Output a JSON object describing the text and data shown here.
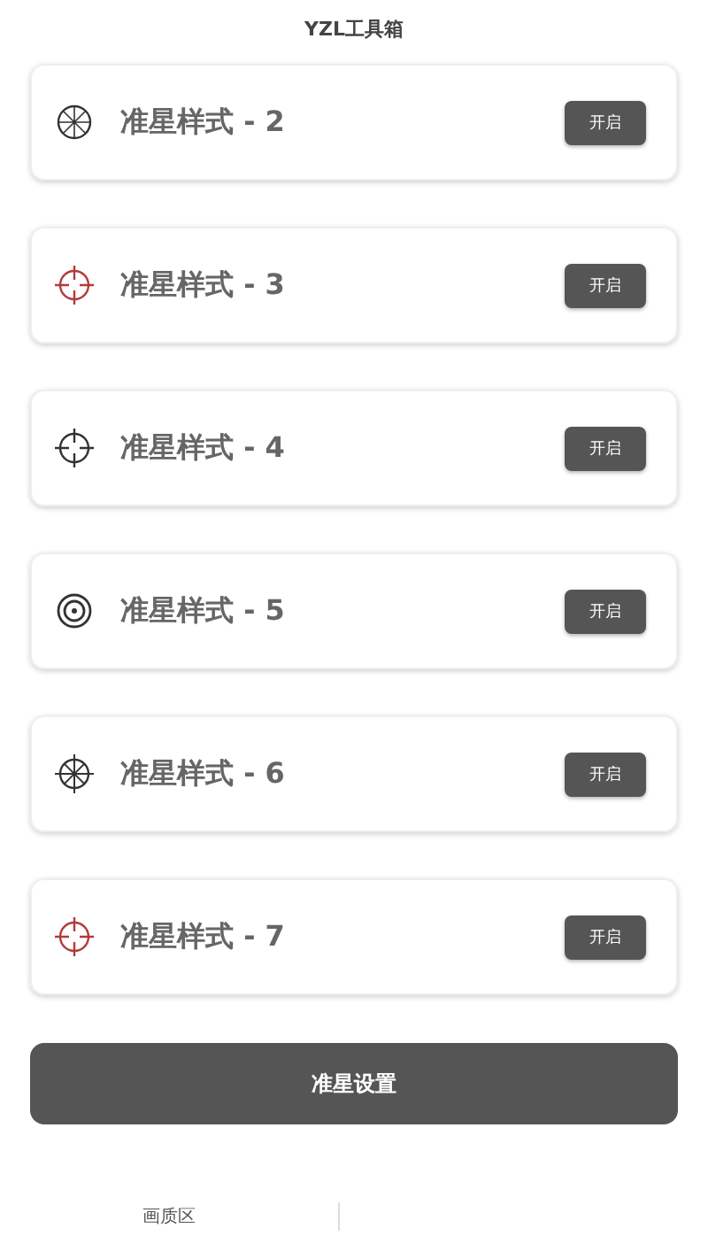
{
  "header": {
    "title": "YZL工具箱"
  },
  "styles": [
    {
      "label": "准星样式 - 2",
      "kind": "wheel",
      "button": "开启"
    },
    {
      "label": "准星样式 - 3",
      "kind": "red-cross",
      "button": "开启"
    },
    {
      "label": "准星样式 - 4",
      "kind": "cross",
      "button": "开启"
    },
    {
      "label": "准星样式 - 5",
      "kind": "ring",
      "button": "开启"
    },
    {
      "label": "准星样式 - 6",
      "kind": "star",
      "button": "开启"
    },
    {
      "label": "准星样式 - 7",
      "kind": "red-cross",
      "button": "开启"
    }
  ],
  "settings_button": "准星设置",
  "bottom_nav": [
    {
      "label": "画质区"
    }
  ]
}
